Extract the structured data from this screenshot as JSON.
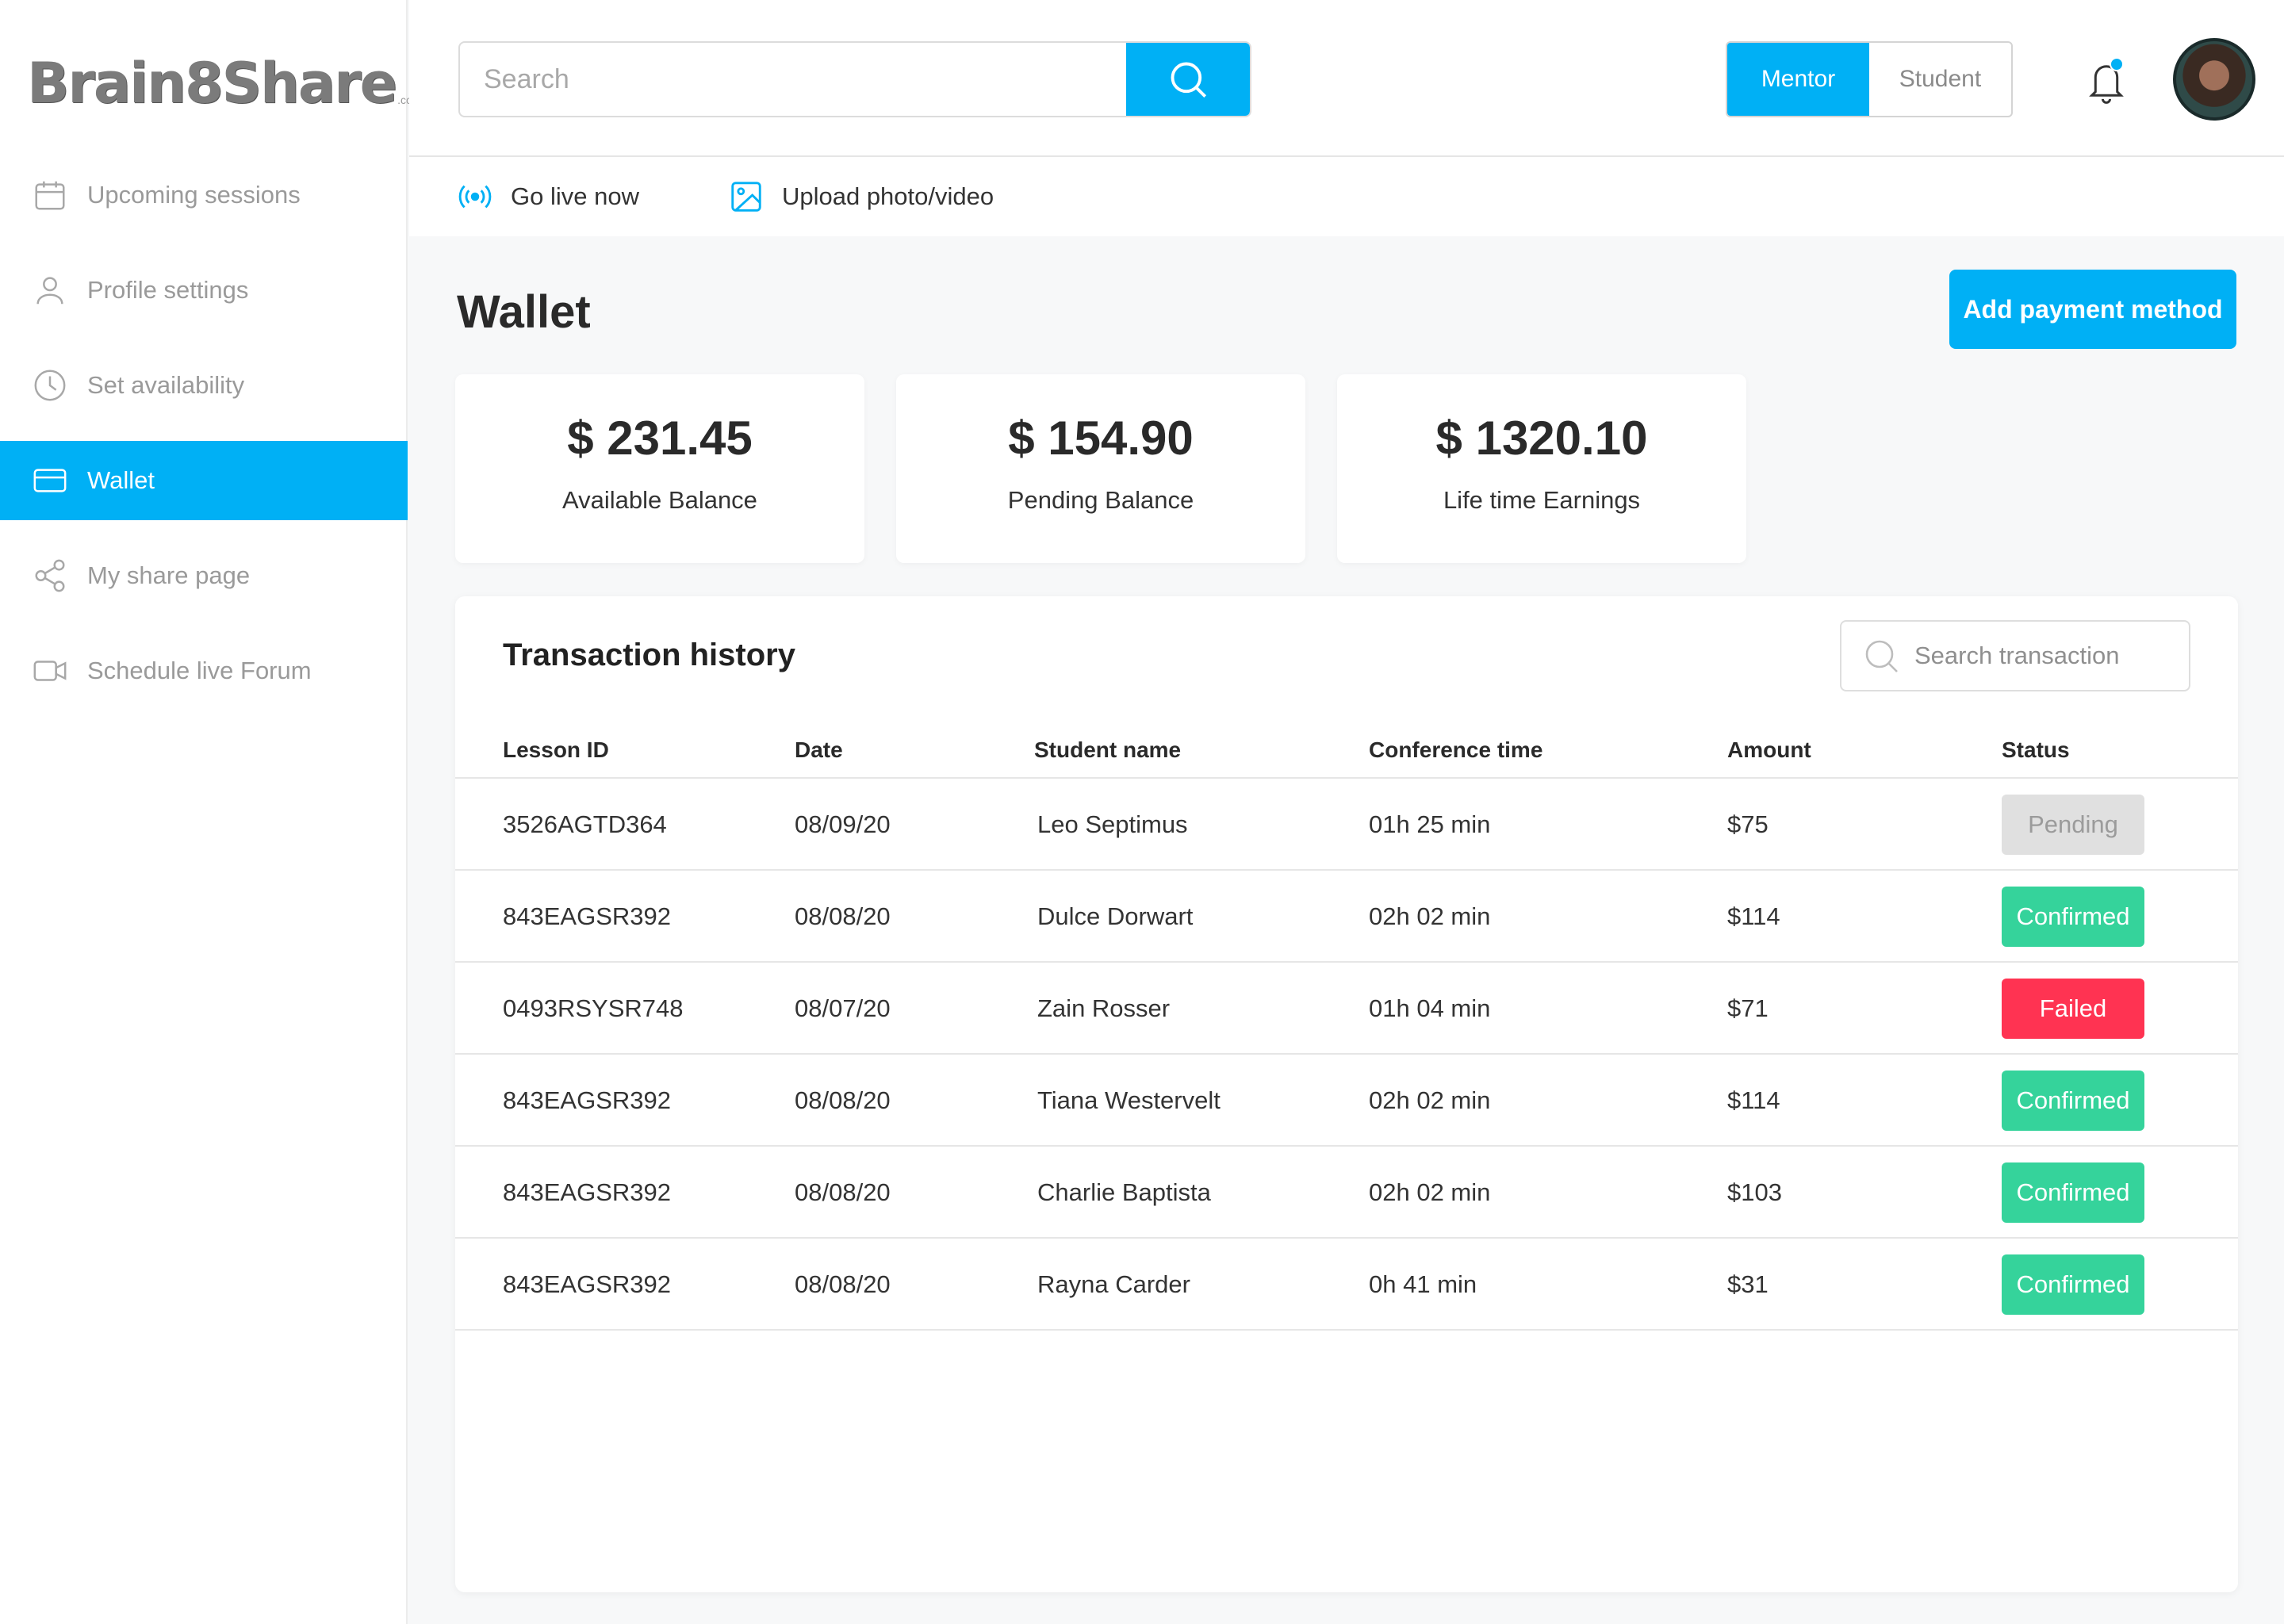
{
  "brand": {
    "name": "Brain8Share",
    "suffix": ".com"
  },
  "sidebar": {
    "items": [
      {
        "label": "Upcoming sessions",
        "icon": "calendar-icon"
      },
      {
        "label": "Profile settings",
        "icon": "user-icon"
      },
      {
        "label": "Set availability",
        "icon": "clock-icon"
      },
      {
        "label": "Wallet",
        "icon": "wallet-icon",
        "active": true
      },
      {
        "label": "My share page",
        "icon": "share-icon"
      },
      {
        "label": "Schedule live Forum",
        "icon": "video-icon"
      }
    ]
  },
  "header": {
    "search_placeholder": "Search",
    "mode_toggle": {
      "options": [
        "Mentor",
        "Student"
      ],
      "selected": "Mentor"
    }
  },
  "subbar": {
    "go_live": "Go live now",
    "upload": "Upload photo/video"
  },
  "wallet": {
    "title": "Wallet",
    "add_payment": "Add payment method",
    "cards": [
      {
        "amount": "$ 231.45",
        "label": "Available Balance"
      },
      {
        "amount": "$ 154.90",
        "label": "Pending Balance"
      },
      {
        "amount": "$ 1320.10",
        "label": "Life time Earnings"
      }
    ]
  },
  "transactions": {
    "title": "Transaction history",
    "search_placeholder": "Search transaction",
    "columns": [
      "Lesson ID",
      "Date",
      "Student name",
      "Conference time",
      "Amount",
      "Status"
    ],
    "rows": [
      {
        "id": "3526AGTD364",
        "date": "08/09/20",
        "student": "Leo Septimus",
        "time": "01h 25 min",
        "amount": "$75",
        "status": "Pending"
      },
      {
        "id": "843EAGSR392",
        "date": "08/08/20",
        "student": "Dulce Dorwart",
        "time": "02h 02 min",
        "amount": "$114",
        "status": "Confirmed"
      },
      {
        "id": "0493RSYSR748",
        "date": "08/07/20",
        "student": "Zain Rosser",
        "time": "01h 04 min",
        "amount": "$71",
        "status": "Failed"
      },
      {
        "id": "843EAGSR392",
        "date": "08/08/20",
        "student": "Tiana Westervelt",
        "time": "02h 02 min",
        "amount": "$114",
        "status": "Confirmed"
      },
      {
        "id": "843EAGSR392",
        "date": "08/08/20",
        "student": "Charlie Baptista",
        "time": "02h 02 min",
        "amount": "$103",
        "status": "Confirmed"
      },
      {
        "id": "843EAGSR392",
        "date": "08/08/20",
        "student": "Rayna Carder",
        "time": "0h 41 min",
        "amount": "$31",
        "status": "Confirmed"
      }
    ]
  },
  "colors": {
    "accent": "#00b0f5",
    "confirmed": "#35d39b",
    "failed": "#ff3352",
    "pending": "#e0e0e0"
  }
}
